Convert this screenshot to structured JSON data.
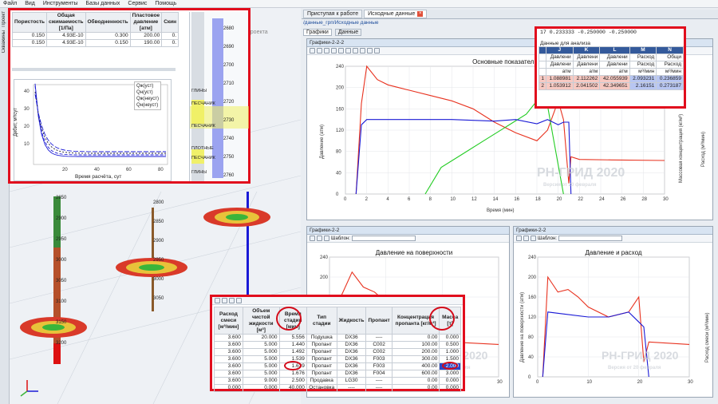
{
  "menu": [
    "Файл",
    "Вид",
    "Инструменты",
    "Базы данных",
    "Сервис",
    "Помощь"
  ],
  "side_tabs": [
    "Проект",
    "Скважины"
  ],
  "tabs": [
    "Приступая к работе",
    "Исходные данные"
  ],
  "path": "/данные_грп/Исходные данные",
  "subtabs": [
    "Графики",
    "Данные"
  ],
  "panels": {
    "main": "Графики-2-2-2",
    "bl": "Графики-2-2",
    "br": "Графики-2-2"
  },
  "template_label": "Шаблон:",
  "main_chart": {
    "title": "Основные показатели",
    "xlabel": "Время (мин)",
    "ylabel_left": "Давление (атм)",
    "ylabel_right1": "Массовая концентрация (кг/м³)",
    "ylabel_right2": "Расход (м³/мин)"
  },
  "bl_chart": {
    "title": "Давление на поверхности"
  },
  "br_chart": {
    "title": "Давление и расход",
    "ylabel_left": "Давление на поверхности (атм)",
    "ylabel_right": "Расход смеси (м³/мин)"
  },
  "watermark": "РН-ГРИД 2020",
  "watermark_sub": "Версия от 20 февраля",
  "props": {
    "headers": [
      "Пористость",
      "Общая сжимаемость [1/Па]",
      "Обводненность",
      "Пластовое давление [атм]",
      "Скин"
    ],
    "rows": [
      [
        "0.150",
        "4.93E-10",
        "0.150",
        "0.300",
        "200.00",
        "0."
      ],
      [
        "0.150",
        "4.93E-10",
        "0.150",
        "190.00",
        "0."
      ]
    ]
  },
  "prod_chart": {
    "ylabel": "Дебит, м³/сут",
    "xlabel": "Время расчёта, сут",
    "legend": [
      "Qж(уст)",
      "Qн(уст)",
      "Qж(неуст)",
      "Qн(неуст)"
    ]
  },
  "well_log": {
    "depths": [
      "2680",
      "2690",
      "2700",
      "2710",
      "2720",
      "2730",
      "2740",
      "2750",
      "2760"
    ],
    "labels": [
      "ГЛИНЫ",
      "ПЕСЧАНИК",
      "ПЕСЧАНИК",
      "ПЛОТНЫЕ",
      "ПЕСЧАНИК",
      "ГЛИНЫ"
    ],
    "projection": "проекта"
  },
  "scene_depths": [
    "2850",
    "2900",
    "2950",
    "3000",
    "3050",
    "3100",
    "3150",
    "3200"
  ],
  "scene_depths2": [
    "2800",
    "2850",
    "2900",
    "2950",
    "3000",
    "3050"
  ],
  "analysis": {
    "header_line": "17  0.233333       -0.250000      -0.250000",
    "title": "Данные для анализа",
    "cols": [
      "J",
      "K",
      "L",
      "M",
      "N"
    ],
    "checks": [
      "Давлени",
      "Давлени",
      "Давлени",
      "Расход",
      "Общи"
    ],
    "names": [
      "Давлени",
      "Давлени",
      "Давлени",
      "Расход",
      "Расход"
    ],
    "units": [
      "атм",
      "атм",
      "атм",
      "м³/мин",
      "м³/мин"
    ],
    "rows": [
      [
        "1",
        "1.088981",
        "2.112262",
        "42.055939",
        "2.093231",
        "0.236859"
      ],
      [
        "2",
        "1.053912",
        "2.041502",
        "42.349651",
        "2.16151",
        "0.273187"
      ]
    ]
  },
  "stages": {
    "headers": [
      "Расход смеси [м³/мин]",
      "Объем чистой жидкости [м³]",
      "Время стадии [мин]",
      "Тип стадии",
      "Жидкость",
      "Пропант",
      "Концентрация пропанта [кг/м³]",
      "Масса [т]"
    ],
    "rows": [
      [
        "3.600",
        "20.000",
        "5.556",
        "Подушка",
        "DX36",
        "----",
        "0.00",
        "0.000"
      ],
      [
        "3.600",
        "5.000",
        "1.440",
        "Пропант",
        "DX36",
        "C002",
        "100.00",
        "0.500"
      ],
      [
        "3.600",
        "5.000",
        "1.492",
        "Пропант",
        "DX36",
        "C002",
        "200.00",
        "1.000"
      ],
      [
        "3.600",
        "5.000",
        "1.539",
        "Пропант",
        "DX36",
        "F003",
        "300.00",
        "1.500"
      ],
      [
        "3.600",
        "5.000",
        "1.639",
        "Пропант",
        "DX36",
        "F003",
        "400.00",
        "2.000"
      ],
      [
        "3.600",
        "5.000",
        "1.676",
        "Пропант",
        "DX36",
        "F004",
        "600.00",
        "3.000"
      ],
      [
        "3.600",
        "9.000",
        "2.500",
        "Продавка",
        "LG30",
        "----",
        "0.00",
        "0.000"
      ],
      [
        "0.000",
        "0.000",
        "40.000",
        "Остановка",
        "----",
        "----",
        "0.00",
        "0.000"
      ]
    ]
  },
  "chart_data": [
    {
      "type": "line",
      "title": "Основные показатели",
      "xlabel": "Время (мин)",
      "xlim": [
        0,
        30
      ],
      "ylim": [
        0,
        240
      ],
      "series": [
        {
          "name": "Давление (атм)",
          "x": [
            1,
            1.5,
            2,
            3,
            4,
            5,
            6,
            8,
            10,
            12,
            14,
            16,
            18,
            19,
            20,
            20.5,
            21,
            21.2,
            22,
            25,
            30
          ],
          "values": [
            0,
            170,
            240,
            215,
            205,
            200,
            195,
            185,
            175,
            160,
            135,
            115,
            100,
            120,
            175,
            140,
            20,
            70,
            65,
            64,
            63
          ]
        },
        {
          "name": "Массовая концентрация (кг/м³)",
          "x": [
            7.5,
            9,
            11,
            13,
            15,
            17,
            18,
            18.5,
            18.7,
            19.5,
            20.5
          ],
          "values": [
            0,
            50,
            75,
            100,
            125,
            150,
            175,
            190,
            200,
            110,
            0
          ]
        },
        {
          "name": "Расход (м³/мин)",
          "x": [
            1,
            1.5,
            2,
            6,
            10,
            14,
            16,
            18,
            19,
            20,
            20.5,
            21,
            21.2
          ],
          "values": [
            0,
            130,
            140,
            140,
            140,
            137,
            140,
            132,
            140,
            130,
            135,
            135,
            0
          ]
        }
      ]
    },
    {
      "type": "line",
      "title": "Давление на поверхности",
      "xlim": [
        0,
        30
      ],
      "ylim": [
        0,
        240
      ],
      "series": [
        {
          "name": "Давление",
          "x": [
            1,
            2,
            4,
            6,
            8,
            10,
            14,
            18,
            20,
            21,
            21.5,
            30
          ],
          "values": [
            0,
            160,
            210,
            180,
            170,
            150,
            120,
            115,
            140,
            20,
            70,
            65
          ]
        }
      ]
    },
    {
      "type": "line",
      "title": "Давление и расход",
      "xlim": [
        0,
        30
      ],
      "ylim": [
        0,
        240
      ],
      "series": [
        {
          "name": "Давление на поверхности (атм)",
          "x": [
            1,
            2,
            4,
            6,
            8,
            10,
            14,
            18,
            20,
            21,
            22,
            30
          ],
          "values": [
            0,
            200,
            170,
            175,
            160,
            140,
            120,
            130,
            160,
            30,
            70,
            65
          ]
        },
        {
          "name": "Расход смеси (м³/мин)",
          "x": [
            1,
            2,
            6,
            10,
            14,
            18,
            20,
            21,
            22
          ],
          "values": [
            0,
            130,
            125,
            120,
            120,
            130,
            110,
            100,
            0
          ]
        }
      ]
    }
  ],
  "colors": {
    "highlight": "#e10d1d",
    "pressure": "#e8321f",
    "conc": "#22cc22",
    "rate": "#1a1ad6"
  }
}
